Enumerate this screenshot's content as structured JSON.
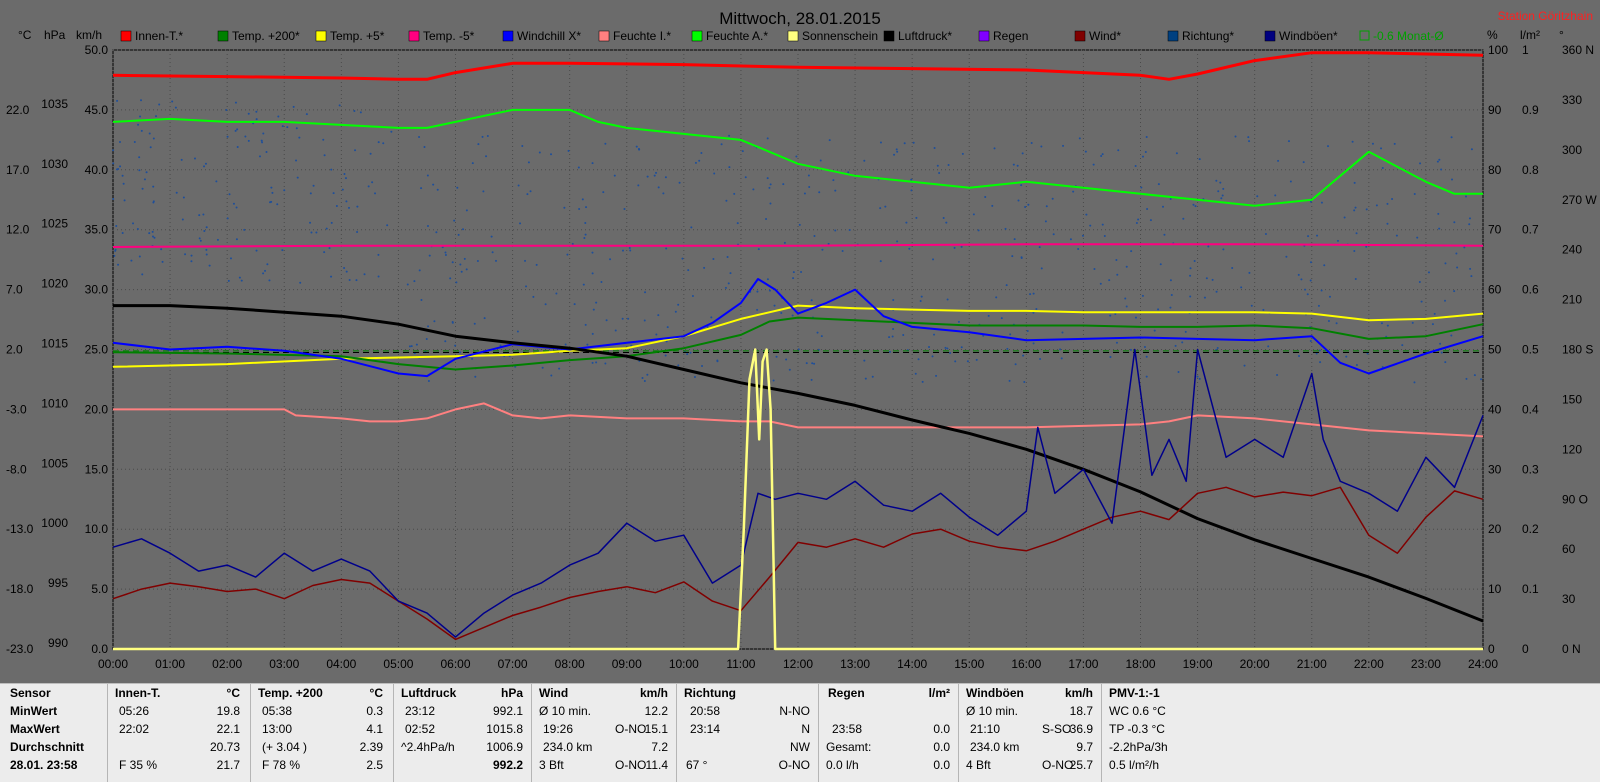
{
  "chart_data": {
    "type": "line",
    "title": "Mittwoch, 28.01.2015",
    "station": "Station Göritzhain",
    "axis_units": {
      "temp": "°C",
      "pressure": "hPa",
      "speed": "km/h",
      "percent": "%",
      "rain": "l/m²",
      "dir": "°"
    },
    "xticks": [
      "00:00",
      "01:00",
      "02:00",
      "03:00",
      "04:00",
      "05:00",
      "06:00",
      "07:00",
      "08:00",
      "09:00",
      "10:00",
      "11:00",
      "12:00",
      "13:00",
      "14:00",
      "15:00",
      "16:00",
      "17:00",
      "18:00",
      "19:00",
      "20:00",
      "21:00",
      "22:00",
      "23:00",
      "24:00"
    ],
    "ticks_temp": [
      "22.0",
      "17.0",
      "12.0",
      "7.0",
      "2.0",
      "-3.0",
      "-8.0",
      "-13.0",
      "-18.0",
      "-23.0"
    ],
    "ticks_pressure": [
      "1035",
      "1030",
      "1025",
      "1020",
      "1015",
      "1010",
      "1005",
      "1000",
      "995",
      "990"
    ],
    "ticks_speed": [
      "50.0",
      "45.0",
      "40.0",
      "35.0",
      "30.0",
      "25.0",
      "20.0",
      "15.0",
      "10.0",
      "5.0",
      "0.0"
    ],
    "ticks_percent": [
      "100",
      "90",
      "80",
      "70",
      "60",
      "50",
      "40",
      "30",
      "20",
      "10",
      "0"
    ],
    "ticks_rain": [
      "1",
      "0.9",
      "0.8",
      "0.7",
      "0.6",
      "0.5",
      "0.4",
      "0.3",
      "0.2",
      "0.1",
      "0"
    ],
    "ticks_dir": [
      "360 N",
      "330",
      "300",
      "270 W",
      "240",
      "210",
      "180 S",
      "150",
      "120",
      "90 O",
      "60",
      "30",
      "0 N"
    ],
    "ylim_speed": [
      0,
      50
    ],
    "ylim_temp": [
      -23,
      22
    ],
    "ylim_pressure": [
      990,
      1035
    ],
    "ylim_percent": [
      0,
      100
    ],
    "legend": [
      {
        "label": "Innen-T.*",
        "color": "#ff0000"
      },
      {
        "label": "Temp. +200*",
        "color": "#008000"
      },
      {
        "label": "Temp. +5*",
        "color": "#ffff00"
      },
      {
        "label": "Temp. -5*",
        "color": "#ff0080"
      },
      {
        "label": "Windchill X*",
        "color": "#0000ff"
      },
      {
        "label": "Feuchte I.*",
        "color": "#ff8080"
      },
      {
        "label": "Feuchte A.*",
        "color": "#00ff00"
      },
      {
        "label": "Sonnenschein",
        "color": "#ffff80"
      },
      {
        "label": "Luftdruck*",
        "color": "#000000"
      },
      {
        "label": "Regen",
        "color": "#8000ff"
      },
      {
        "label": "Wind*",
        "color": "#800000"
      },
      {
        "label": "Richtung*",
        "color": "#004080"
      },
      {
        "label": "Windböen*",
        "color": "#000080"
      },
      {
        "label": "-0.6 Monat-Ø",
        "color": "#00a000"
      }
    ],
    "series": [
      {
        "name": "Innen-T.*",
        "axis": "temp",
        "color": "#ff0000",
        "x": [
          0,
          2,
          4,
          5,
          5.5,
          6,
          7,
          8,
          10,
          12,
          14,
          16,
          17,
          18,
          18.5,
          19,
          20,
          21,
          22,
          23,
          24
        ],
        "y": [
          20.1,
          20.0,
          19.9,
          19.8,
          19.8,
          20.3,
          21.0,
          21.0,
          20.9,
          20.7,
          20.6,
          20.5,
          20.3,
          20.1,
          19.8,
          20.2,
          21.2,
          21.8,
          21.8,
          21.7,
          21.6
        ]
      },
      {
        "name": "Feuchte A.*",
        "axis": "percent",
        "color": "#00ff00",
        "x": [
          0,
          1,
          2,
          3,
          4,
          5,
          5.5,
          6,
          7,
          8,
          8.5,
          9,
          10,
          11,
          11.5,
          12,
          13,
          14,
          15,
          16,
          17,
          18,
          19,
          20,
          21,
          21.5,
          22,
          23,
          23.5,
          24
        ],
        "y": [
          88,
          88.5,
          88,
          88,
          87.5,
          87,
          87,
          88,
          90,
          90,
          88,
          87,
          86,
          85,
          83,
          81,
          79,
          78,
          77,
          78,
          77,
          76,
          75,
          74,
          75,
          79,
          83,
          78,
          76,
          76
        ]
      },
      {
        "name": "Temp. -5*",
        "axis": "temp",
        "color": "#ff0080",
        "x": [
          0,
          4,
          8,
          12,
          16,
          20,
          24
        ],
        "y": [
          7.2,
          7.3,
          7.3,
          7.3,
          7.4,
          7.4,
          7.3
        ]
      },
      {
        "name": "Temp. +5*",
        "axis": "temp",
        "color": "#ffff00",
        "x": [
          0,
          2,
          4,
          5,
          6,
          7,
          8,
          9,
          10,
          11,
          12,
          13,
          14,
          15,
          16,
          17,
          18,
          19,
          20,
          21,
          22,
          23,
          24
        ],
        "y": [
          -1.8,
          -1.6,
          -1.2,
          -1.1,
          -1.0,
          -0.9,
          -0.6,
          -0.4,
          0.5,
          1.8,
          2.8,
          2.6,
          2.5,
          2.4,
          2.4,
          2.3,
          2.3,
          2.3,
          2.3,
          2.2,
          1.7,
          1.8,
          2.2
        ]
      },
      {
        "name": "Temp. +200*",
        "axis": "temp",
        "color": "#008000",
        "x": [
          0,
          2,
          4,
          5,
          6,
          7,
          8,
          9,
          10,
          11,
          11.5,
          12,
          13,
          14,
          15,
          16,
          17,
          18,
          19,
          20,
          21,
          22,
          23,
          24
        ],
        "y": [
          -0.7,
          -0.8,
          -1.0,
          -1.6,
          -2.0,
          -1.7,
          -1.3,
          -1.0,
          -0.4,
          0.6,
          1.6,
          1.9,
          1.7,
          1.5,
          1.3,
          1.3,
          1.3,
          1.2,
          1.2,
          1.3,
          1.1,
          0.3,
          0.5,
          1.4
        ]
      },
      {
        "name": "Windchill X*",
        "axis": "temp",
        "color": "#0000ff",
        "x": [
          0,
          1,
          2,
          3,
          4,
          5,
          5.5,
          6,
          7,
          8,
          9,
          10,
          10.5,
          11,
          11.3,
          11.6,
          12,
          12.5,
          13,
          13.5,
          14,
          15,
          16,
          17,
          18,
          19,
          20,
          21,
          21.5,
          22,
          23,
          24
        ],
        "y": [
          0.0,
          -0.5,
          -0.3,
          -0.6,
          -1.2,
          -2.3,
          -2.5,
          -1.2,
          -0.1,
          -0.5,
          0.0,
          0.5,
          1.5,
          3.0,
          4.8,
          4.0,
          2.2,
          3.0,
          4.0,
          2.0,
          1.2,
          0.8,
          0.2,
          0.3,
          0.4,
          0.3,
          0.2,
          0.5,
          -1.5,
          -2.3,
          -0.8,
          0.5
        ]
      },
      {
        "name": "Feuchte I.*",
        "axis": "percent",
        "color": "#ff8080",
        "x": [
          0,
          3,
          3.2,
          4,
          4.5,
          5,
          5.5,
          6,
          6.5,
          7,
          7.5,
          8,
          9,
          10,
          11,
          11.5,
          12,
          14,
          16,
          18,
          18.5,
          19,
          20,
          21,
          22,
          23,
          24
        ],
        "y": [
          40,
          40,
          39,
          38.5,
          38,
          38,
          38.5,
          40,
          41,
          39,
          38.5,
          39,
          38.5,
          38.5,
          38,
          38,
          37,
          37,
          37,
          37.5,
          38,
          39,
          38.5,
          37.5,
          36.5,
          36,
          35.5
        ]
      },
      {
        "name": "Luftdruck*",
        "axis": "pressure",
        "color": "#000000",
        "x": [
          0,
          1,
          2,
          3,
          4,
          5,
          6,
          7,
          8,
          9,
          10,
          11,
          12,
          13,
          14,
          15,
          16,
          17,
          18,
          19,
          20,
          21,
          22,
          23,
          24
        ],
        "y": [
          1015.8,
          1015.8,
          1015.6,
          1015.3,
          1015.0,
          1014.4,
          1013.5,
          1013.0,
          1012.6,
          1012.0,
          1011.0,
          1010.0,
          1009.2,
          1008.3,
          1007.2,
          1006.2,
          1005.0,
          1003.5,
          1001.8,
          999.8,
          998.2,
          996.8,
          995.4,
          993.8,
          992.1
        ]
      },
      {
        "name": "Wind*",
        "axis": "speed",
        "color": "#800000",
        "x": [
          0,
          0.5,
          1,
          1.5,
          2,
          2.5,
          3,
          3.5,
          4,
          4.5,
          5,
          5.5,
          6,
          6.5,
          7,
          7.5,
          8,
          8.5,
          9,
          9.5,
          10,
          10.5,
          11,
          11.5,
          12,
          12.5,
          13,
          13.5,
          14,
          14.5,
          15,
          15.5,
          16,
          16.5,
          17,
          17.5,
          18,
          18.5,
          19,
          19.5,
          20,
          20.5,
          21,
          21.5,
          22,
          22.5,
          23,
          23.5,
          24
        ],
        "y": [
          4.2,
          5.0,
          5.5,
          5.2,
          4.8,
          5.0,
          4.2,
          5.3,
          5.8,
          5.5,
          4.0,
          2.5,
          0.8,
          1.8,
          2.8,
          3.5,
          4.3,
          4.8,
          5.2,
          4.7,
          5.6,
          4.0,
          3.2,
          6.0,
          8.9,
          8.5,
          9.2,
          8.5,
          9.6,
          10.0,
          9.0,
          8.5,
          8.2,
          9.0,
          10.0,
          11.0,
          11.5,
          10.8,
          13.0,
          13.5,
          12.7,
          13.1,
          12.8,
          13.5,
          9.5,
          8.0,
          11.0,
          13.2,
          12.5
        ]
      },
      {
        "name": "Windböen*",
        "axis": "speed",
        "color": "#00008b",
        "x": [
          0,
          0.5,
          1,
          1.5,
          2,
          2.5,
          3,
          3.5,
          4,
          4.5,
          5,
          5.5,
          6,
          6.5,
          7,
          7.5,
          8,
          8.5,
          9,
          9.5,
          10,
          10.5,
          11,
          11.3,
          11.6,
          12,
          12.5,
          13,
          13.5,
          14,
          14.5,
          15,
          15.5,
          16,
          16.2,
          16.5,
          17,
          17.5,
          17.9,
          18.2,
          18.5,
          18.8,
          19,
          19.5,
          20,
          20.5,
          21,
          21.2,
          21.5,
          22,
          22.5,
          23,
          23.5,
          24
        ],
        "y": [
          8.5,
          9.2,
          8.0,
          6.5,
          7.0,
          6.0,
          8.0,
          6.5,
          7.5,
          6.5,
          4.0,
          3.0,
          1.0,
          3.0,
          4.5,
          5.5,
          7.0,
          8.0,
          10.5,
          9.0,
          9.5,
          5.5,
          7.0,
          13.0,
          12.5,
          13.0,
          12.5,
          14.0,
          12.0,
          11.5,
          13.0,
          11.0,
          9.5,
          11.5,
          18.5,
          13.0,
          15.0,
          10.5,
          25.0,
          14.5,
          17.5,
          14.0,
          25.0,
          16.0,
          17.5,
          16.0,
          23.0,
          17.5,
          14.0,
          13.0,
          11.5,
          16.0,
          13.5,
          19.5
        ]
      },
      {
        "name": "Sonnenschein",
        "axis": "percent",
        "color": "#ffff80",
        "x": [
          0,
          10.95,
          11.05,
          11.15,
          11.25,
          11.32,
          11.38,
          11.45,
          11.52,
          11.6,
          24
        ],
        "y": [
          0,
          0,
          20,
          45,
          50,
          35,
          48,
          50,
          40,
          0,
          0
        ]
      }
    ],
    "richtung_scatter": {
      "axis": "dir",
      "note": "dots scattered 150–320°"
    }
  },
  "panel": {
    "sensor": {
      "header": "Sensor",
      "rows": [
        "MinWert",
        "MaxWert",
        "Durchschnitt",
        "28.01. 23:58"
      ]
    },
    "innen": {
      "header": "Innen-T.",
      "unit": "°C",
      "rows": [
        [
          "05:26",
          "19.8"
        ],
        [
          "22:02",
          "22.1"
        ],
        [
          "",
          "20.73"
        ],
        [
          "F 35 %",
          "21.7"
        ]
      ]
    },
    "temp200": {
      "header": "Temp. +200",
      "unit": "°C",
      "rows": [
        [
          "05:38",
          "0.3"
        ],
        [
          "13:00",
          "4.1"
        ],
        [
          "(+ 3.04 )",
          "2.39"
        ],
        [
          "F 78 %",
          "2.5"
        ]
      ]
    },
    "luftdruck": {
      "header": "Luftdruck",
      "unit": "hPa",
      "rows": [
        [
          "23:12",
          "992.1"
        ],
        [
          "02:52",
          "1015.8"
        ],
        [
          "^2.4hPa/h",
          "1006.9"
        ],
        [
          "",
          "992.2"
        ]
      ]
    },
    "wind": {
      "header": "Wind",
      "unit": "km/h",
      "rows": [
        [
          "Ø 10 min.",
          "",
          "12.2"
        ],
        [
          "19:26",
          "O-NO",
          "15.1"
        ],
        [
          "234.0 km",
          "",
          "7.2"
        ],
        [
          "3 Bft",
          "O-NO",
          "11.4"
        ]
      ]
    },
    "richtung": {
      "header": "Richtung",
      "unit": "",
      "rows": [
        [
          "20:58",
          "N-NO"
        ],
        [
          "23:14",
          "N"
        ],
        [
          "",
          "NW"
        ],
        [
          "67 °",
          "O-NO"
        ]
      ]
    },
    "regen": {
      "header": "Regen",
      "unit": "l/m²",
      "rows": [
        [
          "",
          ""
        ],
        [
          "23:58",
          "0.0"
        ],
        [
          "Gesamt:",
          "0.0"
        ],
        [
          "0.0 l/h",
          "0.0"
        ]
      ]
    },
    "windboeen": {
      "header": "Windböen",
      "unit": "km/h",
      "rows": [
        [
          "Ø 10 min.",
          "",
          "18.7"
        ],
        [
          "21:10",
          "S-SO",
          "36.9"
        ],
        [
          "234.0 km",
          "",
          "9.7"
        ],
        [
          "4 Bft",
          "O-NO",
          "25.7"
        ]
      ]
    },
    "pmv": {
      "header": "PMV-1:-1",
      "rows": [
        "WC 0.6 °C",
        "TP -0.3 °C",
        "-2.2hPa/3h",
        "0.5 l/m²/h"
      ]
    }
  }
}
